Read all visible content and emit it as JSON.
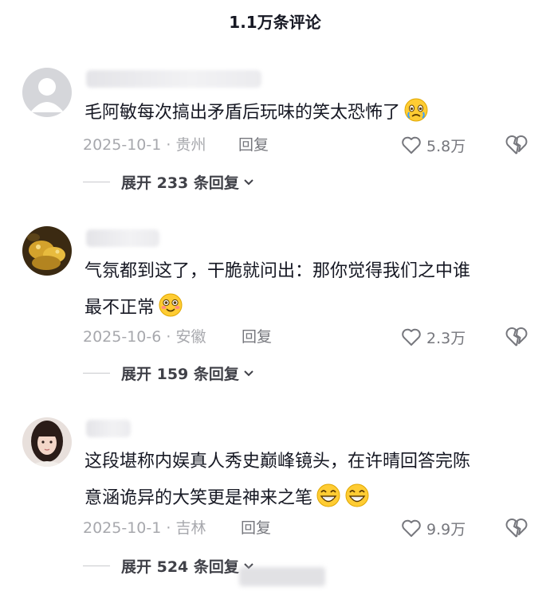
{
  "header": {
    "title": "1.1万条评论"
  },
  "comments": [
    {
      "text": "毛阿敏每次搞出矛盾后玩味的笑太恐怖了",
      "emoji": [
        "crying-face-emoji"
      ],
      "date_location": "2025-10-1 · 贵州",
      "reply_label": "回复",
      "like_count": "5.8万",
      "expand_label": "展开 233 条回复"
    },
    {
      "text_line1": "气氛都到这了，干脆就问出：那你觉得我们之中谁",
      "text_line2": "最不正常",
      "emoji": [
        "flushed-smile-emoji"
      ],
      "date_location": "2025-10-6 · 安徽",
      "reply_label": "回复",
      "like_count": "2.3万",
      "expand_label": "展开 159 条回复"
    },
    {
      "text_line1": "这段堪称内娱真人秀史巅峰镜头，在许晴回答完陈",
      "text_line2": "意涵诡异的大笑更是神来之笔",
      "emoji": [
        "grinning-emoji",
        "grinning-emoji"
      ],
      "date_location": "2025-10-1 · 吉林",
      "reply_label": "回复",
      "like_count": "9.9万",
      "expand_label": "展开 524 条回复"
    }
  ],
  "icons": {
    "heart": "heart-outline-icon",
    "broken_heart": "broken-heart-icon",
    "chevron": "chevron-down-icon"
  },
  "colors": {
    "text": "#161823",
    "meta": "#a7a8ad",
    "action": "#76777d"
  }
}
